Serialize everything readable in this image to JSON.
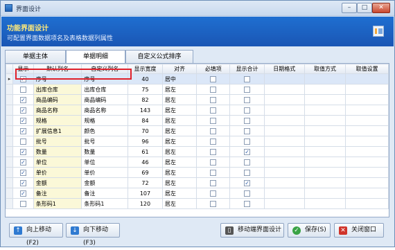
{
  "window": {
    "title": "界面设计"
  },
  "header": {
    "title": "功能界面设计",
    "subtitle": "可配置界面数据项名及表格数据列属性"
  },
  "tabs": [
    {
      "label": "单据主体"
    },
    {
      "label": "单据明细",
      "active": true
    },
    {
      "label": "自定义公式排序"
    }
  ],
  "grid": {
    "columns": [
      "显示",
      "默认列名",
      "自定义列名",
      "显示宽度",
      "对齐",
      "必填项",
      "显示合计",
      "日期格式",
      "取值方式",
      "取值设置"
    ],
    "current_row_marker": "▸",
    "rows": [
      {
        "show": true,
        "default": "序号",
        "custom": "序号",
        "width": "40",
        "align": "居中",
        "required": false,
        "total": false
      },
      {
        "show": false,
        "default": "出库仓库",
        "custom": "出库仓库",
        "width": "75",
        "align": "居左",
        "required": false,
        "total": false
      },
      {
        "show": true,
        "default": "商品编码",
        "custom": "商品编码",
        "width": "82",
        "align": "居左",
        "required": false,
        "total": false
      },
      {
        "show": true,
        "default": "商品名称",
        "custom": "商品名称",
        "width": "143",
        "align": "居左",
        "required": false,
        "total": false
      },
      {
        "show": true,
        "default": "规格",
        "custom": "规格",
        "width": "84",
        "align": "居左",
        "required": false,
        "total": false
      },
      {
        "show": true,
        "default": "扩展信息1",
        "custom": "颜色",
        "width": "70",
        "align": "居左",
        "required": false,
        "total": false
      },
      {
        "show": false,
        "default": "批号",
        "custom": "批号",
        "width": "96",
        "align": "居左",
        "required": false,
        "total": false
      },
      {
        "show": true,
        "default": "数量",
        "custom": "数量",
        "width": "61",
        "align": "居左",
        "required": false,
        "total": true
      },
      {
        "show": true,
        "default": "单位",
        "custom": "单位",
        "width": "46",
        "align": "居左",
        "required": false,
        "total": false
      },
      {
        "show": true,
        "default": "单价",
        "custom": "单价",
        "width": "69",
        "align": "居左",
        "required": false,
        "total": false
      },
      {
        "show": true,
        "default": "金额",
        "custom": "金额",
        "width": "72",
        "align": "居左",
        "required": false,
        "total": true
      },
      {
        "show": true,
        "default": "备注",
        "custom": "备注",
        "width": "107",
        "align": "居左",
        "required": false,
        "total": false
      },
      {
        "show": false,
        "default": "条形码1",
        "custom": "条形码1",
        "width": "120",
        "align": "居左",
        "required": false,
        "total": false
      }
    ]
  },
  "buttons": {
    "move_up": "向上移动(F2)",
    "move_down": "向下移动(F3)",
    "mobile_design": "移动端界面设计",
    "save": "保存(S)",
    "close": "关闭窗口"
  },
  "colors": {
    "header_bg": "#1f6fd1",
    "header_title": "#ffea7a",
    "highlight_box": "#e0202a"
  }
}
